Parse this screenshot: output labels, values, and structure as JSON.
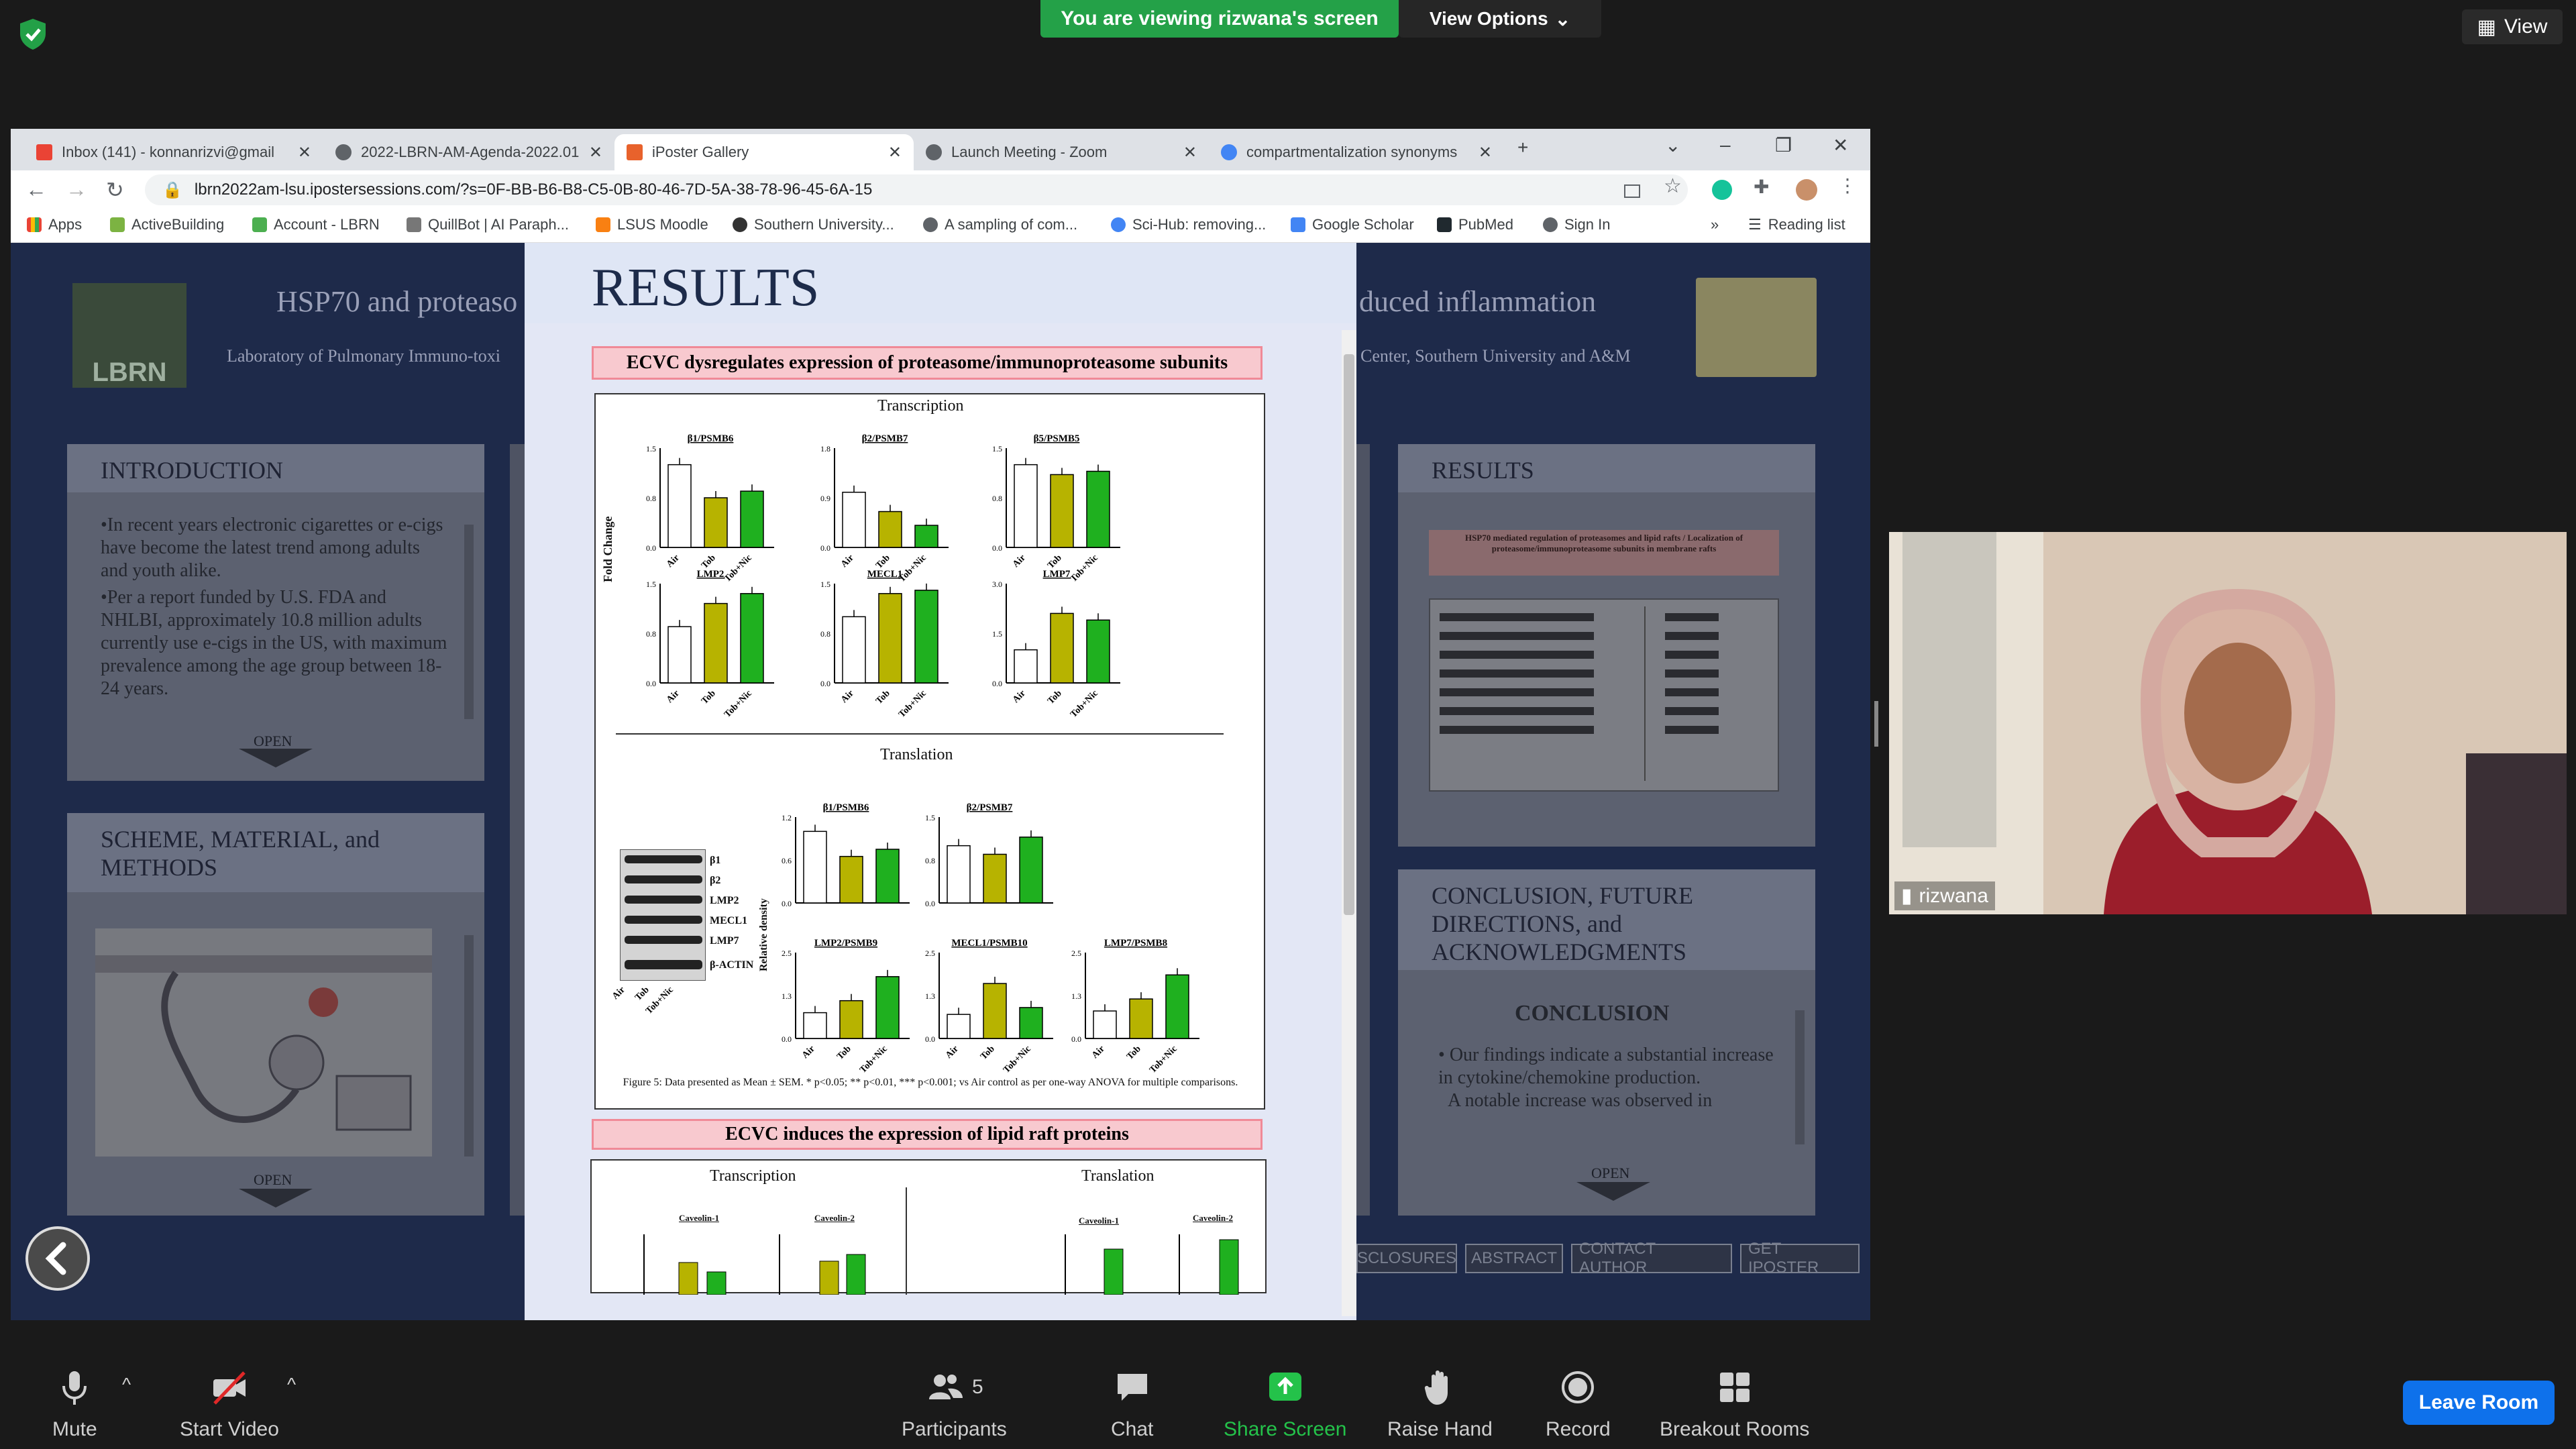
{
  "zoom": {
    "viewing_banner": "You are viewing rizwana's screen",
    "view_options": "View Options",
    "view_label": "View",
    "participants_count": "5",
    "participant_name": "rizwana"
  },
  "toolbar": {
    "mute": "Mute",
    "start_video": "Start Video",
    "participants": "Participants",
    "chat": "Chat",
    "share_screen": "Share Screen",
    "raise_hand": "Raise Hand",
    "record": "Record",
    "breakout_rooms": "Breakout Rooms",
    "leave_room": "Leave Room"
  },
  "browser": {
    "tabs": [
      {
        "label": "Inbox (141) - konnanrizvi@gmail",
        "active": false
      },
      {
        "label": "2022-LBRN-AM-Agenda-2022.01",
        "active": false
      },
      {
        "label": "iPoster Gallery",
        "active": true
      },
      {
        "label": "Launch Meeting - Zoom",
        "active": false
      },
      {
        "label": "compartmentalization synonyms",
        "active": false
      }
    ],
    "url": "lbrn2022am-lsu.ipostersessions.com/?s=0F-BB-B6-B8-C5-0B-80-46-7D-5A-38-78-96-45-6A-15",
    "bookmarks": [
      "Apps",
      "ActiveBuilding",
      "Account - LBRN",
      "QuillBot | AI Paraph...",
      "LSUS Moodle",
      "Southern University...",
      "A sampling of com...",
      "Sci-Hub: removing...",
      "Google Scholar",
      "PubMed",
      "Sign In"
    ],
    "more": "»",
    "reading_list": "Reading list"
  },
  "poster": {
    "title_left": "HSP70 and proteaso",
    "title_right": "duced inflammation",
    "subtitle_left": "Laboratory of Pulmonary Immuno-toxi",
    "subtitle_right": "Center,  Southern University and A&M",
    "logo": "LBRN",
    "intro": {
      "heading": "INTRODUCTION",
      "p1": "•In recent years electronic cigarettes or e-cigs have become the latest trend among adults and youth alike.",
      "p2": "•Per a report funded by U.S. FDA and NHLBI, approximately 10.8 million adults currently use e-cigs in the US, with maximum prevalence among the age group between 18-24 years.",
      "open": "OPEN"
    },
    "scheme": {
      "heading": "SCHEME, MATERIAL, and METHODS",
      "open": "OPEN"
    },
    "results_right": {
      "heading": "RESULTS",
      "fig_title": "HSP70 mediated regulation of proteasomes and lipid rafts / Localization of proteasome/immunoproteasome subunits in membrane rafts"
    },
    "conclusion": {
      "heading": "CONCLUSION, FUTURE DIRECTIONS, and ACKNOWLEDGMENTS",
      "sub": "CONCLUSION",
      "bullet": "Our findings indicate a substantial increase in cytokine/chemokine production.",
      "bullet2": "A notable increase was observed in",
      "open": "OPEN"
    },
    "footer_buttons": [
      "SCLOSURES",
      "ABSTRACT",
      "CONTACT AUTHOR",
      "GET IPOSTER"
    ]
  },
  "modal": {
    "heading": "RESULTS",
    "figbar1": "ECVC dysregulates expression of proteasome/immunoproteasome subunits",
    "figbar2": "ECVC induces the expression of lipid raft proteins",
    "transcription": "Transcription",
    "translation": "Translation",
    "ylabel_fold": "Fold Change",
    "ylabel_density": "Relative density",
    "caption": "Figure 5: Data presented as Mean ± SEM. * p<0.05; ** p<0.01, *** p<0.001; vs Air control as per one-way ANOVA for multiple comparisons.",
    "groups": [
      "Air",
      "Tob",
      "Tob+Nic"
    ],
    "blot_labels": [
      "β1",
      "β2",
      "LMP2",
      "MECL1",
      "LMP7",
      "β-ACTIN"
    ],
    "fig2_charts": [
      "Caveolin-1",
      "Caveolin-2"
    ]
  },
  "chart_data": [
    {
      "type": "bar",
      "title": "β1/PSMB6",
      "categories": [
        "Air",
        "Tob",
        "Tob+Nic"
      ],
      "values": [
        1.25,
        0.75,
        0.85
      ],
      "ylim": [
        0,
        1.5
      ],
      "ylabel": "Fold Change"
    },
    {
      "type": "bar",
      "title": "β2/PSMB7",
      "categories": [
        "Air",
        "Tob",
        "Tob+Nic"
      ],
      "values": [
        1.0,
        0.65,
        0.4
      ],
      "ylim": [
        0,
        1.8
      ]
    },
    {
      "type": "bar",
      "title": "β5/PSMB5",
      "categories": [
        "Air",
        "Tob",
        "Tob+Nic"
      ],
      "values": [
        1.25,
        1.1,
        1.15
      ],
      "ylim": [
        0,
        1.5
      ]
    },
    {
      "type": "bar",
      "title": "LMP2",
      "categories": [
        "Air",
        "Tob",
        "Tob+Nic"
      ],
      "values": [
        0.85,
        1.2,
        1.35
      ],
      "ylim": [
        0,
        1.5
      ]
    },
    {
      "type": "bar",
      "title": "MECL1",
      "categories": [
        "Air",
        "Tob",
        "Tob+Nic"
      ],
      "values": [
        1.0,
        1.35,
        1.4
      ],
      "ylim": [
        0,
        1.5
      ]
    },
    {
      "type": "bar",
      "title": "LMP7",
      "categories": [
        "Air",
        "Tob",
        "Tob+Nic"
      ],
      "values": [
        1.0,
        2.1,
        1.9
      ],
      "ylim": [
        0,
        3.0
      ]
    },
    {
      "type": "bar",
      "title": "β1/PSMB6",
      "categories": [
        "Air",
        "Tob",
        "Tob+Nic"
      ],
      "values": [
        1.0,
        0.65,
        0.75
      ],
      "ylim": [
        0,
        1.2
      ],
      "ylabel": "Relative density"
    },
    {
      "type": "bar",
      "title": "β2/PSMB7",
      "categories": [
        "Air",
        "Tob",
        "Tob+Nic"
      ],
      "values": [
        1.0,
        0.85,
        1.15
      ],
      "ylim": [
        0,
        1.5
      ]
    },
    {
      "type": "bar",
      "title": "LMP2/PSMB9",
      "categories": [
        "Air",
        "Tob",
        "Tob+Nic"
      ],
      "values": [
        0.75,
        1.1,
        1.8
      ],
      "ylim": [
        0,
        2.5
      ]
    },
    {
      "type": "bar",
      "title": "MECL1/PSMB10",
      "categories": [
        "Air",
        "Tob",
        "Tob+Nic"
      ],
      "values": [
        0.7,
        1.6,
        0.9
      ],
      "ylim": [
        0,
        2.5
      ]
    },
    {
      "type": "bar",
      "title": "LMP7/PSMB8",
      "categories": [
        "Air",
        "Tob",
        "Tob+Nic"
      ],
      "values": [
        0.8,
        1.15,
        1.85
      ],
      "ylim": [
        0,
        2.5
      ]
    }
  ],
  "colors": {
    "zoom_green": "#24a148",
    "leave_blue": "#0e71eb",
    "bar_air": "#ffffff",
    "bar_tob": "#b7b300",
    "bar_tobnic": "#1fb01f",
    "figbar_pink": "#f8c9cf",
    "poster_bg": "#1e2a4a"
  }
}
